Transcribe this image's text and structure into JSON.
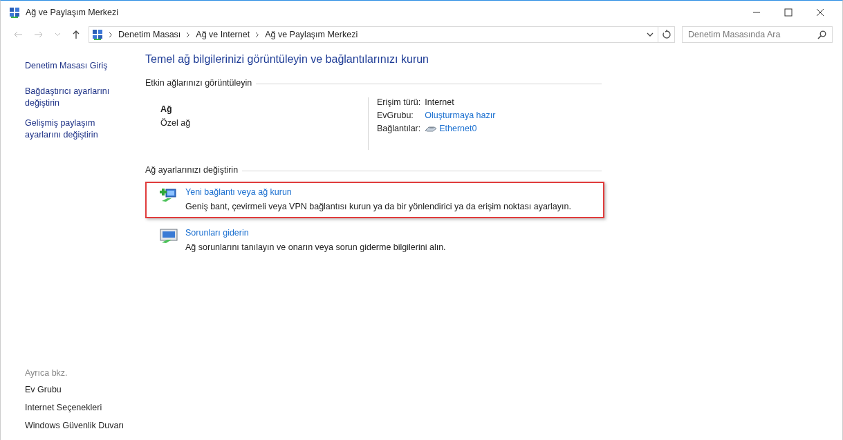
{
  "window": {
    "title": "Ağ ve Paylaşım Merkezi"
  },
  "address_bar": {
    "breadcrumbs": [
      "Denetim Masası",
      "Ağ ve Internet",
      "Ağ ve Paylaşım Merkezi"
    ]
  },
  "search": {
    "placeholder": "Denetim Masasında Ara"
  },
  "sidebar": {
    "links": [
      "Denetim Masası Giriş",
      "Bağdaştırıcı ayarlarını değiştirin",
      "Gelişmiş paylaşım ayarlarını değiştirin"
    ],
    "see_also": {
      "heading": "Ayrıca bkz.",
      "links": [
        "Ev Grubu",
        "Internet Seçenekleri",
        "Windows Güvenlik Duvarı"
      ]
    }
  },
  "main": {
    "heading": "Temel ağ bilgilerinizi görüntüleyin ve bağlantılarınızı kurun",
    "active_networks": {
      "heading": "Etkin ağlarınızı görüntüleyin",
      "network_name": "Ağ",
      "network_type": "Özel ağ",
      "properties": [
        {
          "label": "Erişim türü:",
          "value": "Internet",
          "kind": "text"
        },
        {
          "label": "EvGrubu:",
          "value": "Oluşturmaya hazır",
          "kind": "link"
        },
        {
          "label": "Bağlantılar:",
          "value": "Ethernet0",
          "kind": "connection"
        }
      ]
    },
    "change_settings": {
      "heading": "Ağ ayarlarınızı değiştirin",
      "tasks": [
        {
          "title": "Yeni bağlantı veya ağ kurun",
          "description": "Geniş bant, çevirmeli veya VPN bağlantısı kurun ya da bir yönlendirici ya da erişim noktası ayarlayın.",
          "kind": "new-connection",
          "highlighted": true
        },
        {
          "title": "Sorunları giderin",
          "description": "Ağ sorunlarını tanılayın ve onarın veya sorun giderme bilgilerini alın.",
          "kind": "troubleshoot",
          "highlighted": false
        }
      ]
    }
  }
}
